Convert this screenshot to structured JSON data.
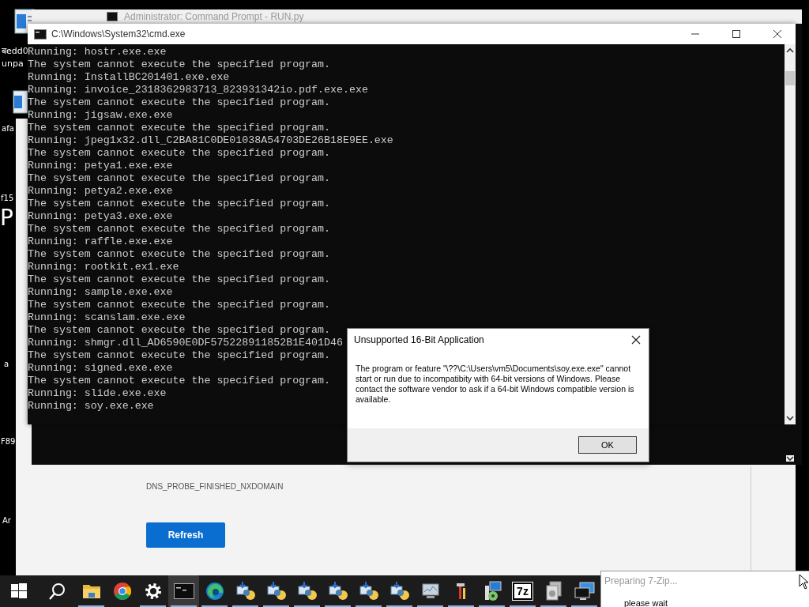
{
  "desktop": {
    "labels": [
      "बedd0",
      "unpa",
      "afa",
      "f15",
      "P",
      "a",
      "F89",
      "Ar"
    ]
  },
  "browser": {
    "error_code": "DNS_PROBE_FINISHED_NXDOMAIN",
    "button": "Refresh"
  },
  "admin_console": {
    "title": "Administrator: Command Prompt - RUN.py"
  },
  "console": {
    "title": "C:\\Windows\\System32\\cmd.exe",
    "lines": [
      "Running: hostr.exe.exe",
      "The system cannot execute the specified program.",
      "Running: InstallBC201401.exe.exe",
      "Running: invoice_2318362983713_823931342io.pdf.exe.exe",
      "The system cannot execute the specified program.",
      "Running: jigsaw.exe.exe",
      "The system cannot execute the specified program.",
      "Running: jpeg1x32.dll_C2BA81C0DE01038A54703DE26B18E9EE.exe",
      "The system cannot execute the specified program.",
      "Running: petya1.exe.exe",
      "The system cannot execute the specified program.",
      "Running: petya2.exe.exe",
      "The system cannot execute the specified program.",
      "Running: petya3.exe.exe",
      "The system cannot execute the specified program.",
      "Running: raffle.exe.exe",
      "The system cannot execute the specified program.",
      "Running: rootkit.ex1.exe",
      "The system cannot execute the specified program.",
      "Running: sample.exe.exe",
      "The system cannot execute the specified program.",
      "Running: scanslam.exe.exe",
      "The system cannot execute the specified program.",
      "Running: shmgr.dll_AD6590E0DF575228911852B1E401D46",
      "The system cannot execute the specified program.",
      "Running: signed.exe.exe",
      "The system cannot execute the specified program.",
      "Running: slide.exe.exe",
      "Running: soy.exe.exe"
    ]
  },
  "dialog": {
    "title": "Unsupported 16-Bit Application",
    "message": "The program or feature \"\\??\\C:\\Users\\vm5\\Documents\\soy.exe.exe\" cannot start or run due to incompatibity with 64-bit versions of Windows. Please contact the software vendor to ask if a 64-bit Windows compatible version is available.",
    "button": "OK"
  },
  "taskbar": {
    "items": [
      {
        "kind": "start",
        "running": false,
        "selected": false
      },
      {
        "kind": "search",
        "running": false,
        "selected": false
      },
      {
        "kind": "folder",
        "running": true,
        "selected": false
      },
      {
        "kind": "chrome",
        "running": false,
        "selected": false
      },
      {
        "kind": "settings",
        "running": true,
        "selected": false
      },
      {
        "kind": "terminal",
        "running": true,
        "selected": true
      },
      {
        "kind": "edge",
        "running": true,
        "selected": false
      },
      {
        "kind": "installer",
        "running": true,
        "selected": false
      },
      {
        "kind": "installer",
        "running": true,
        "selected": false
      },
      {
        "kind": "installer",
        "running": true,
        "selected": false
      },
      {
        "kind": "installer",
        "running": true,
        "selected": false
      },
      {
        "kind": "installer",
        "running": true,
        "selected": false
      },
      {
        "kind": "installer",
        "running": true,
        "selected": false
      },
      {
        "kind": "monitor",
        "running": true,
        "selected": false
      },
      {
        "kind": "tools",
        "running": true,
        "selected": false
      },
      {
        "kind": "disc",
        "running": true,
        "selected": false
      },
      {
        "kind": "archive",
        "label": "7z",
        "running": true,
        "selected": false
      },
      {
        "kind": "documents",
        "running": true,
        "selected": false
      },
      {
        "kind": "computer",
        "running": true,
        "selected": false
      }
    ]
  },
  "popup": {
    "title": "Preparing 7-Zip...",
    "text": "please wait"
  }
}
